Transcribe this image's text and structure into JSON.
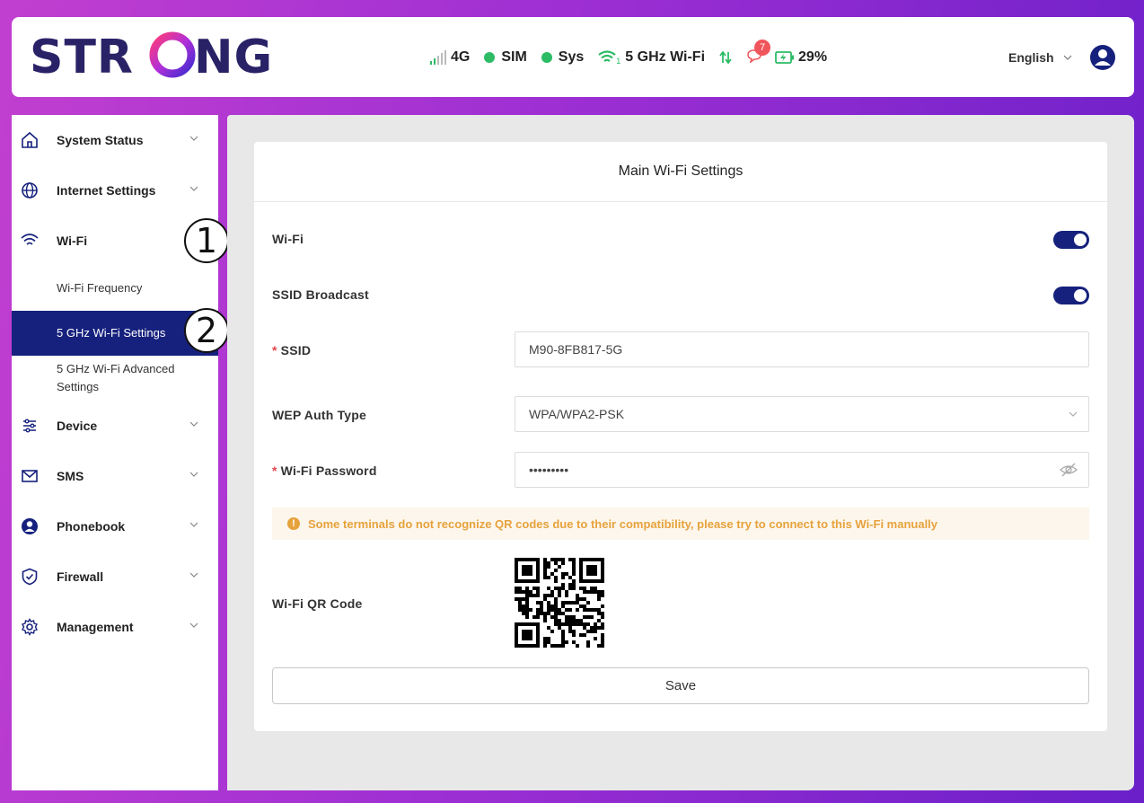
{
  "brand": {
    "logo_text": "STRONG"
  },
  "status": {
    "network": "4G",
    "sim": "SIM",
    "sys": "Sys",
    "wifi": "5 GHz Wi-Fi",
    "wifi_clients": "1",
    "messages_count": "7",
    "battery": "29%",
    "ok_color": "#2dbb66"
  },
  "header": {
    "language": "English"
  },
  "sidebar": {
    "items": [
      {
        "label": "System Status",
        "icon": "home-icon"
      },
      {
        "label": "Internet Settings",
        "icon": "globe-icon"
      },
      {
        "label": "Wi-Fi",
        "icon": "wifi-icon"
      },
      {
        "label": "Device",
        "icon": "sliders-icon"
      },
      {
        "label": "SMS",
        "icon": "mail-icon"
      },
      {
        "label": "Phonebook",
        "icon": "person-icon"
      },
      {
        "label": "Firewall",
        "icon": "shield-icon"
      },
      {
        "label": "Management",
        "icon": "gear-icon"
      }
    ],
    "wifi_sub": [
      {
        "label": "Wi-Fi Frequency"
      },
      {
        "label": "5 GHz Wi-Fi Settings",
        "active": true
      },
      {
        "label_line1": "5 GHz Wi-Fi Advanced",
        "label_line2": "Settings"
      }
    ],
    "accent_color": "#16217d"
  },
  "callouts": [
    "1",
    "2"
  ],
  "form": {
    "title": "Main Wi-Fi Settings",
    "wifi_label": "Wi-Fi",
    "wifi_enabled": true,
    "ssid_broadcast_label": "SSID Broadcast",
    "ssid_broadcast_enabled": true,
    "required_mark": "*",
    "ssid_label": "SSID",
    "ssid_value": "M90-8FB817-5G",
    "auth_label": "WEP Auth Type",
    "auth_value": "WPA/WPA2-PSK",
    "password_label": "Wi-Fi Password",
    "password_value": "•••••••••",
    "warning": "Some terminals do not recognize QR codes due to their compatibility, please try to connect to this Wi-Fi manually",
    "warning_icon": "!",
    "qr_label": "Wi-Fi QR Code",
    "save_label": "Save"
  }
}
